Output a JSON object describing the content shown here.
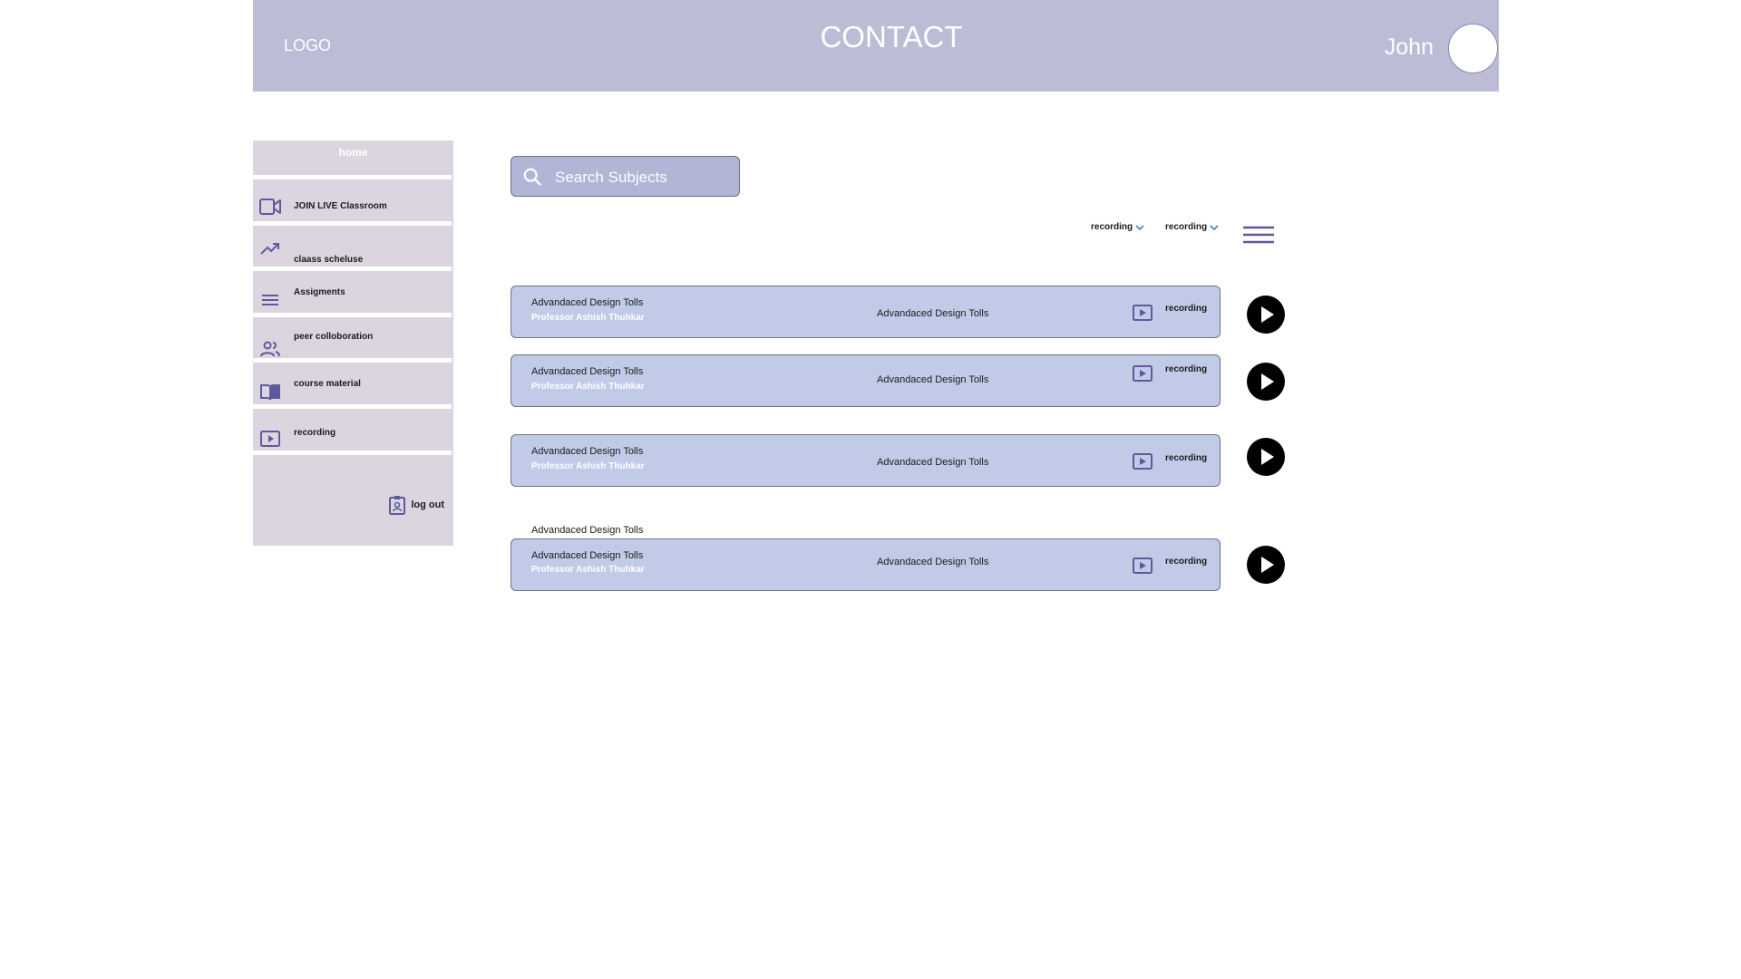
{
  "header": {
    "logo": "LOGO",
    "title": "CONTACT",
    "username": "John"
  },
  "sidebar": {
    "home": "home",
    "items": [
      {
        "label": "JOIN LIVE Classroom",
        "icon": "video-camera-icon"
      },
      {
        "label": "claass scheluse",
        "icon": "trending-up-icon"
      },
      {
        "label": "Assigments",
        "icon": "list-lines-icon"
      },
      {
        "label": "peer colloboration",
        "icon": "people-icon"
      },
      {
        "label": "course material",
        "icon": "open-book-icon"
      },
      {
        "label": "recording",
        "icon": "play-box-icon"
      }
    ],
    "logout": "log out"
  },
  "search": {
    "placeholder": "Search Subjects"
  },
  "filters": [
    {
      "label": "recording"
    },
    {
      "label": "recording"
    }
  ],
  "colors": {
    "header_bg": "#bdbcd6",
    "sidebar_bg": "#dcd5df",
    "card_bg": "#c1cbe8",
    "search_bg": "#b1b5d6",
    "accent_icon": "#5d5a9c",
    "chevron": "#3d8fd6"
  },
  "recordings": [
    {
      "title": "Advandaced Design Tolls",
      "professor": "Professor Ashish Thuhkar",
      "subject": "Advandaced Design Tolls",
      "status": "recording"
    },
    {
      "title": "Advandaced Design Tolls",
      "professor": "Professor Ashish Thuhkar",
      "subject": "Advandaced Design Tolls",
      "status": "recording"
    },
    {
      "title": "Advandaced Design Tolls",
      "professor": "Professor Ashish Thuhkar",
      "subject": "Advandaced Design Tolls",
      "status": "recording"
    },
    {
      "title": "Advandaced Design Tolls",
      "professor": "Professor Ashish Thuhkar",
      "subject": "Advandaced Design Tolls",
      "status": "recording"
    }
  ],
  "extra_label": "Advandaced Design Tolls"
}
